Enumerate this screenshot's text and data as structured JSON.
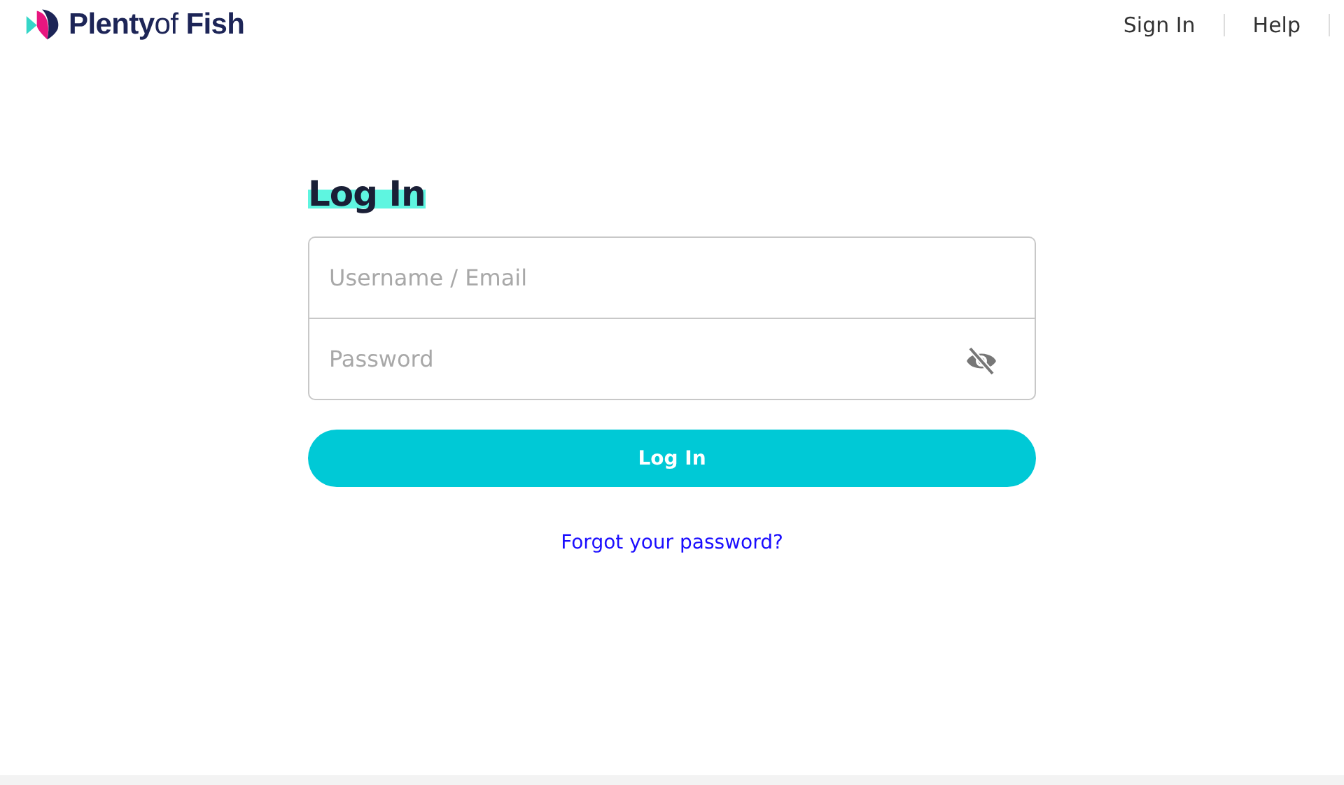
{
  "header": {
    "logo": "**Plenty**of **Fish**",
    "nav": [
      {
        "label": "Sign In"
      },
      {
        "label": "Help"
      }
    ]
  },
  "form": {
    "title": "Log In",
    "username": {
      "placeholder": "Username / Email"
    },
    "password": {
      "placeholder": "Password",
      "visible": false
    },
    "submit": "Log In",
    "forgot_link": "Forgot your password?"
  }
}
